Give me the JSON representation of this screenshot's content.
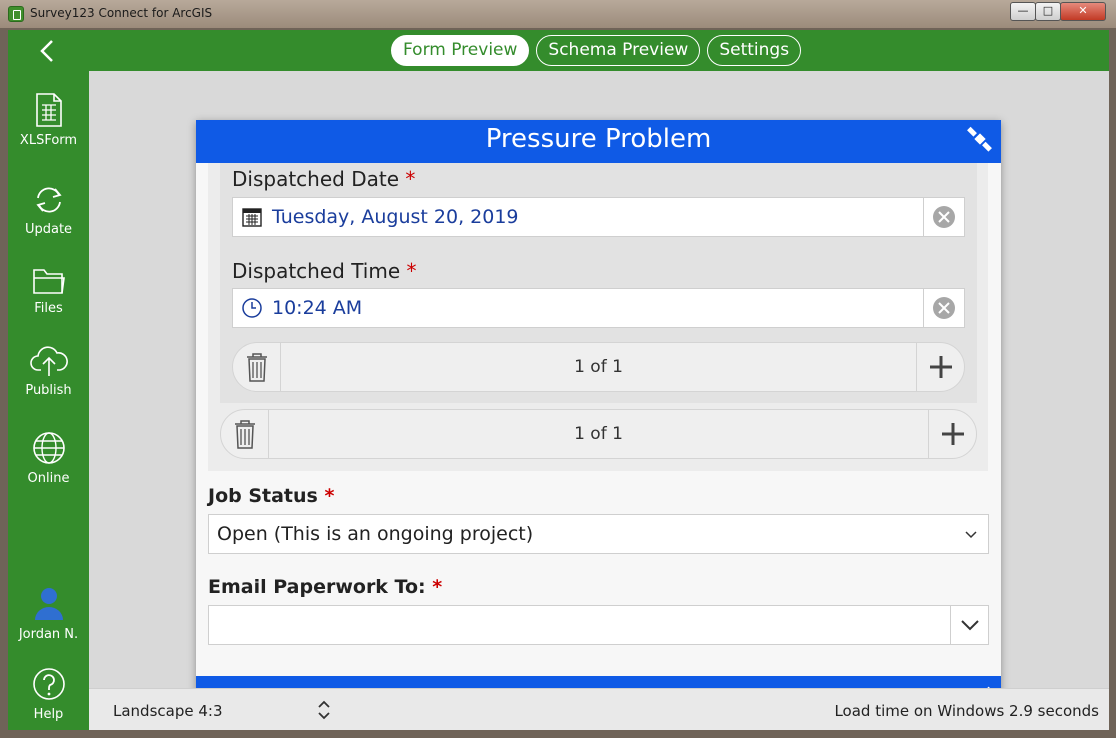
{
  "window": {
    "title": "Survey123 Connect for ArcGIS",
    "buttons": {
      "minimize": "—",
      "maximize": "□",
      "close": "✕"
    }
  },
  "topbar": {
    "tabs": [
      {
        "label": "Form Preview",
        "active": true
      },
      {
        "label": "Schema Preview",
        "active": false
      },
      {
        "label": "Settings",
        "active": false
      }
    ]
  },
  "sidebar": {
    "items": [
      {
        "label": "XLSForm",
        "icon": "spreadsheet-icon"
      },
      {
        "label": "Update",
        "icon": "refresh-icon"
      },
      {
        "label": "Files",
        "icon": "folder-icon"
      },
      {
        "label": "Publish",
        "icon": "cloud-upload-icon"
      },
      {
        "label": "Online",
        "icon": "globe-icon"
      }
    ],
    "user": {
      "label": "Jordan N.",
      "icon": "user-icon"
    },
    "help": {
      "label": "Help",
      "icon": "help-icon"
    }
  },
  "form": {
    "title": "Pressure Problem",
    "dispatched_date": {
      "label": "Dispatched Date",
      "required": "*",
      "value": "Tuesday, August 20, 2019"
    },
    "dispatched_time": {
      "label": "Dispatched Time",
      "required": "*",
      "value": "10:24 AM"
    },
    "inner_pager": {
      "count": "1 of 1"
    },
    "outer_pager": {
      "count": "1 of 1"
    },
    "job_status": {
      "label": "Job Status",
      "required": "*",
      "value": "Open (This is an ongoing project)"
    },
    "email_paperwork": {
      "label": "Email Paperwork To:",
      "required": "*",
      "value": ""
    }
  },
  "bottombar": {
    "orientation": "Landscape 4:3",
    "load_time": "Load time on Windows 2.9 seconds"
  },
  "colors": {
    "brand_green": "#348c2c",
    "form_blue": "#0f5ae6",
    "value_blue": "#1a3d9c",
    "required_red": "#cc0000"
  }
}
